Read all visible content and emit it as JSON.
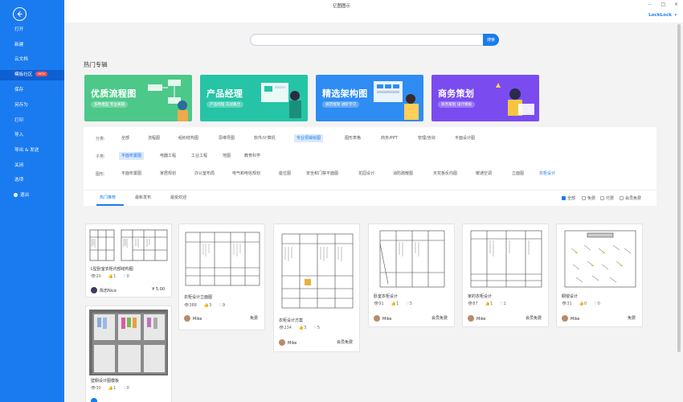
{
  "app": {
    "title": "亿图图示",
    "user": "LockLock"
  },
  "sidebar": {
    "items": [
      {
        "label": "打开"
      },
      {
        "label": "新建"
      },
      {
        "label": "云文档"
      },
      {
        "label": "模板社区",
        "badge": "NEW"
      },
      {
        "label": "保存"
      },
      {
        "label": "另存为"
      },
      {
        "label": "打印"
      },
      {
        "label": "导入"
      },
      {
        "label": "导出 & 发送"
      },
      {
        "label": "关闭"
      },
      {
        "label": "选项"
      },
      {
        "label": "退出"
      }
    ]
  },
  "search": {
    "placeholder": "",
    "button": "搜索"
  },
  "hot": {
    "title": "热门专辑",
    "banners": [
      {
        "title": "优质流程图",
        "subtitle": "多种类型 专业离隔",
        "color": "#4cc889"
      },
      {
        "title": "产品经理",
        "subtitle": "产品经理 实战集合",
        "color": "#26c4a6"
      },
      {
        "title": "精选架构图",
        "subtitle": "规范框架 进阶学习",
        "color": "#2f8cf2"
      },
      {
        "title": "商务策划",
        "subtitle": "商务策划 设计模板",
        "color": "#7a4cf0"
      }
    ]
  },
  "filters": {
    "category_label": "分类:",
    "categories": [
      "全部",
      "流程图",
      "组织结构图",
      "思维导图",
      "软件/计算机",
      "专业领域绘图",
      "图形表格",
      "商务/PPT",
      "管理/咨询",
      "平面设计图"
    ],
    "subcategory_label": "子类:",
    "subcategories": [
      "平面布置图",
      "电器工程",
      "工业工程",
      "地图",
      "教育科学"
    ],
    "shape_label": "图形:",
    "shapes": [
      "平面布置图",
      "家居规划",
      "办公室布局",
      "电气和电信规划",
      "座位图",
      "安全和门禁平面图",
      "花园设计",
      "消防疏散图",
      "天花板反向图",
      "暖通空调",
      "立面图",
      "衣柜设计"
    ]
  },
  "sort": {
    "tabs": [
      "热门推荐",
      "最新发布",
      "最受欢迎"
    ],
    "checkboxes": [
      "全部",
      "免费",
      "付费",
      "会员免费"
    ]
  },
  "cards": [
    {
      "title": "L型卧室衣柜内部结构图",
      "views": "20",
      "likes": "1",
      "favs": "0",
      "author": "陈忠Nice",
      "price": "¥ 5.00"
    },
    {
      "title": "衣柜设计立面图",
      "views": "388",
      "likes": "3",
      "favs": "9",
      "author": "Mike",
      "price": "免费"
    },
    {
      "title": "衣柜设计方案",
      "views": "234",
      "likes": "3",
      "favs": "5",
      "author": "Mike",
      "price": "会员免费"
    },
    {
      "title": "卧室衣柜设计",
      "views": "91",
      "likes": "1",
      "favs": "3",
      "author": "Mike",
      "price": "会员免费"
    },
    {
      "title": "家的衣柜设计",
      "views": "87",
      "likes": "1",
      "favs": "1",
      "author": "Mike",
      "price": "会员免费"
    },
    {
      "title": "橱窗设计",
      "views": "31",
      "likes": "0",
      "favs": "0",
      "author": "Mike",
      "price": "免费"
    },
    {
      "title": "壁橱设计图模板",
      "views": "30",
      "likes": "1",
      "favs": "0",
      "author": "",
      "price": ""
    }
  ],
  "colors": {
    "accent": "#1a7bf0",
    "sidebar": "#1a7bf0",
    "badge": "#ff4d4f"
  }
}
